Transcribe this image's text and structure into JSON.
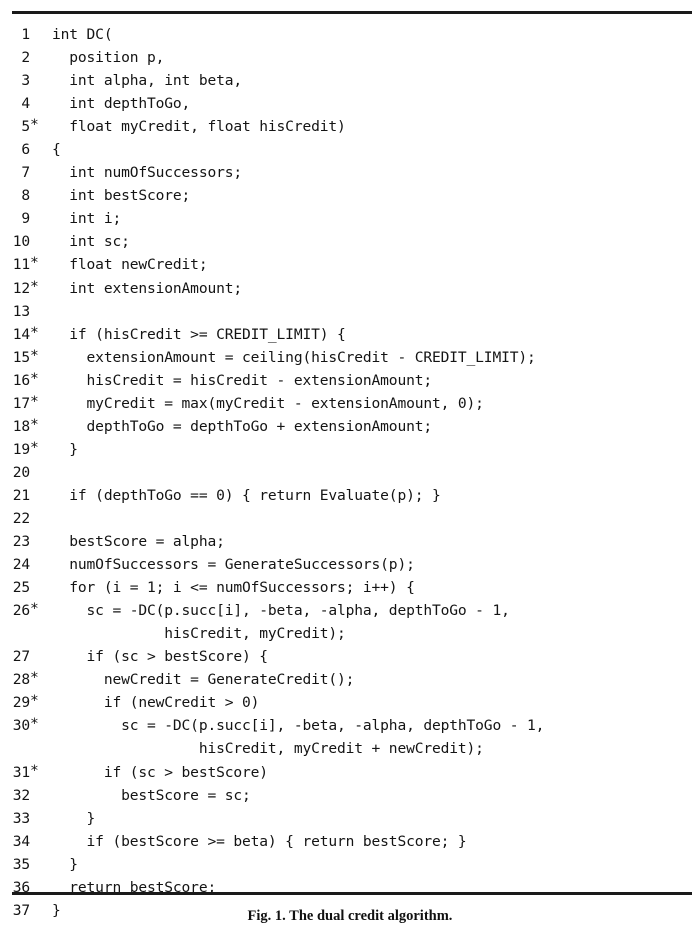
{
  "figure": {
    "caption": "Fig. 1. The dual credit algorithm.",
    "rule_color": "#1a1a1a",
    "text_color": "#141414",
    "background": "#ffffff",
    "star_marker": "*",
    "code_lines": [
      {
        "number": "1",
        "marker": "",
        "text": "int DC("
      },
      {
        "number": "2",
        "marker": "",
        "text": "  position p,"
      },
      {
        "number": "3",
        "marker": "",
        "text": "  int alpha, int beta,"
      },
      {
        "number": "4",
        "marker": "",
        "text": "  int depthToGo,"
      },
      {
        "number": "5",
        "marker": "*",
        "text": "  float myCredit, float hisCredit)"
      },
      {
        "number": "6",
        "marker": "",
        "text": "{"
      },
      {
        "number": "7",
        "marker": "",
        "text": "  int numOfSuccessors;"
      },
      {
        "number": "8",
        "marker": "",
        "text": "  int bestScore;"
      },
      {
        "number": "9",
        "marker": "",
        "text": "  int i;"
      },
      {
        "number": "10",
        "marker": "",
        "text": "  int sc;"
      },
      {
        "number": "11",
        "marker": "*",
        "text": "  float newCredit;"
      },
      {
        "number": "12",
        "marker": "*",
        "text": "  int extensionAmount;"
      },
      {
        "number": "13",
        "marker": "",
        "text": ""
      },
      {
        "number": "14",
        "marker": "*",
        "text": "  if (hisCredit >= CREDIT_LIMIT) {"
      },
      {
        "number": "15",
        "marker": "*",
        "text": "    extensionAmount = ceiling(hisCredit - CREDIT_LIMIT);"
      },
      {
        "number": "16",
        "marker": "*",
        "text": "    hisCredit = hisCredit - extensionAmount;"
      },
      {
        "number": "17",
        "marker": "*",
        "text": "    myCredit = max(myCredit - extensionAmount, 0);"
      },
      {
        "number": "18",
        "marker": "*",
        "text": "    depthToGo = depthToGo + extensionAmount;"
      },
      {
        "number": "19",
        "marker": "*",
        "text": "  }"
      },
      {
        "number": "20",
        "marker": "",
        "text": ""
      },
      {
        "number": "21",
        "marker": "",
        "text": "  if (depthToGo == 0) { return Evaluate(p); }"
      },
      {
        "number": "22",
        "marker": "",
        "text": ""
      },
      {
        "number": "23",
        "marker": "",
        "text": "  bestScore = alpha;"
      },
      {
        "number": "24",
        "marker": "",
        "text": "  numOfSuccessors = GenerateSuccessors(p);"
      },
      {
        "number": "25",
        "marker": "",
        "text": "  for (i = 1; i <= numOfSuccessors; i++) {"
      },
      {
        "number": "26",
        "marker": "*",
        "text": "    sc = -DC(p.succ[i], -beta, -alpha, depthToGo - 1,"
      },
      {
        "number": "",
        "marker": "",
        "text": "             hisCredit, myCredit);"
      },
      {
        "number": "27",
        "marker": "",
        "text": "    if (sc > bestScore) {"
      },
      {
        "number": "28",
        "marker": "*",
        "text": "      newCredit = GenerateCredit();"
      },
      {
        "number": "29",
        "marker": "*",
        "text": "      if (newCredit > 0)"
      },
      {
        "number": "30",
        "marker": "*",
        "text": "        sc = -DC(p.succ[i], -beta, -alpha, depthToGo - 1,"
      },
      {
        "number": "",
        "marker": "",
        "text": "                 hisCredit, myCredit + newCredit);"
      },
      {
        "number": "31",
        "marker": "*",
        "text": "      if (sc > bestScore)"
      },
      {
        "number": "32",
        "marker": "",
        "text": "        bestScore = sc;"
      },
      {
        "number": "33",
        "marker": "",
        "text": "    }"
      },
      {
        "number": "34",
        "marker": "",
        "text": "    if (bestScore >= beta) { return bestScore; }"
      },
      {
        "number": "35",
        "marker": "",
        "text": "  }"
      },
      {
        "number": "36",
        "marker": "",
        "text": "  return bestScore;"
      },
      {
        "number": "37",
        "marker": "",
        "text": "}"
      }
    ]
  }
}
